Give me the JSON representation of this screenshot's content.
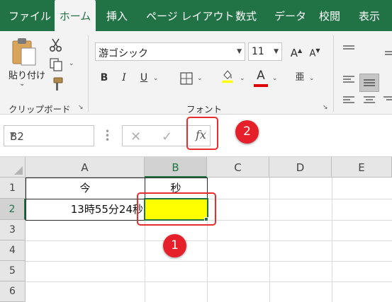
{
  "ribbon": {
    "tabs": [
      {
        "label": "ファイル",
        "active": false
      },
      {
        "label": "ホーム",
        "active": true
      },
      {
        "label": "挿入",
        "active": false
      },
      {
        "label": "ページ レイアウト",
        "active": false
      },
      {
        "label": "数式",
        "active": false
      },
      {
        "label": "データ",
        "active": false
      },
      {
        "label": "校閲",
        "active": false
      },
      {
        "label": "表示",
        "active": false
      }
    ],
    "clipboard": {
      "paste_label": "貼り付け",
      "group_label": "クリップボード"
    },
    "font": {
      "font_name": "游ゴシック",
      "font_size": "11",
      "group_label": "フォント"
    },
    "accent_color": "#217346"
  },
  "formula_bar": {
    "name_box": "B2",
    "fx_label": "fx",
    "formula": ""
  },
  "sheet": {
    "columns": [
      "A",
      "B",
      "C",
      "D",
      "E"
    ],
    "rows": [
      "1",
      "2",
      "3",
      "4",
      "5",
      "6"
    ],
    "selected_cell": "B2",
    "cells": {
      "A1": "今",
      "B1": "秒",
      "A2": "13時55分24秒"
    },
    "fill_color_B2": "#ffff00"
  },
  "annotations": {
    "badge_1": "1",
    "badge_2": "2",
    "highlight_color": "#e62e2e"
  }
}
